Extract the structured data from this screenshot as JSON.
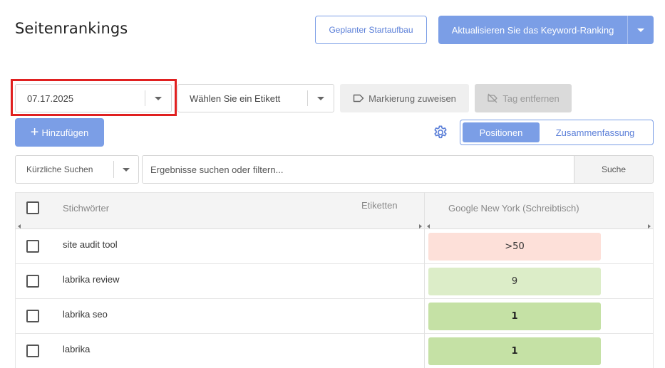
{
  "header": {
    "title": "Seitenrankings",
    "scheduled_button": "Geplanter Startaufbau",
    "update_button": "Aktualisieren Sie das Keyword-Ranking"
  },
  "toolbar": {
    "date_value": "07.17.2025",
    "tag_placeholder": "Wählen Sie ein Etikett",
    "assign_label": "Markierung zuweisen",
    "remove_label": "Tag entfernen",
    "add_label": "Hinzufügen",
    "view_toggle": {
      "options": [
        "Positionen",
        "Zusammenfassung"
      ],
      "selected": "Positionen"
    }
  },
  "search": {
    "recent_label": "Kürzliche Suchen",
    "placeholder": "Ergebnisse suchen oder filtern...",
    "button": "Suche"
  },
  "table": {
    "headers": {
      "keywords": "Stichwörter",
      "tags": "Etiketten",
      "engine": "Google New York (Schreibtisch)"
    },
    "rows": [
      {
        "keyword": "site audit tool",
        "position": ">50",
        "color": "#fde0d9"
      },
      {
        "keyword": "labrika review",
        "position": "9",
        "color": "#dcedc8"
      },
      {
        "keyword": "labrika seo",
        "position": "1",
        "color": "#c5e1a5"
      },
      {
        "keyword": "labrika",
        "position": "1",
        "color": "#c5e1a5"
      }
    ]
  },
  "colors": {
    "accent": "#7b9ee6",
    "highlight": "#e02020"
  }
}
